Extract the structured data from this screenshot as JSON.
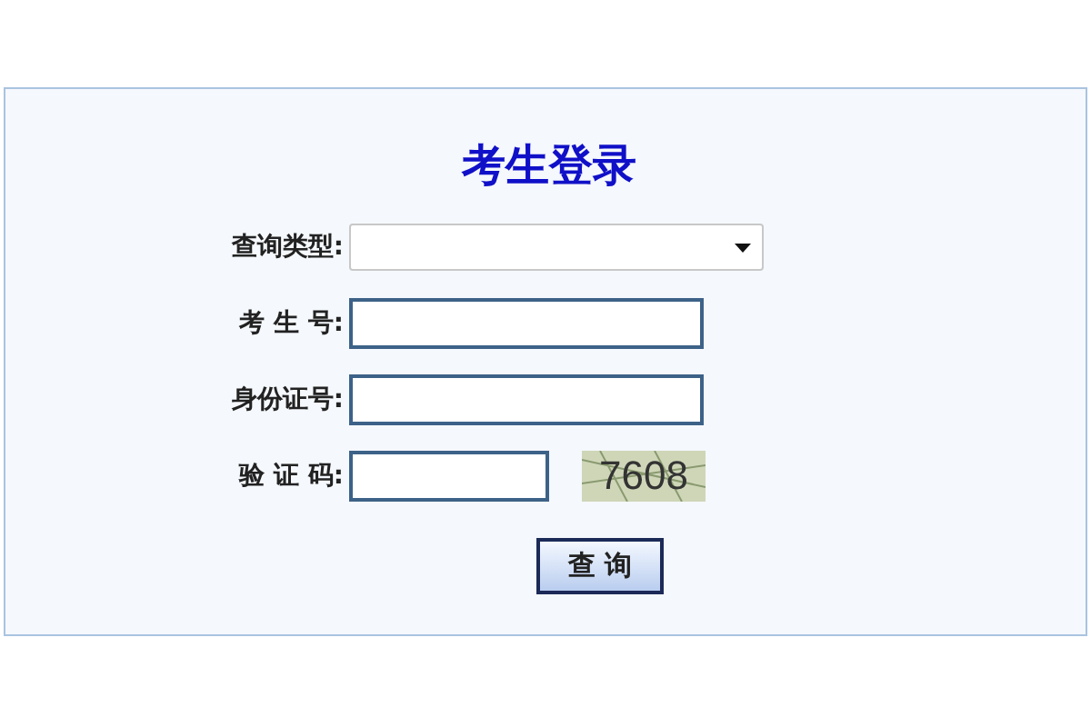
{
  "title": "考生登录",
  "fields": [
    {
      "kind": "select",
      "label": "查询类型:"
    },
    {
      "kind": "text",
      "label": "考 生 号:"
    },
    {
      "kind": "text",
      "label": "身份证号:"
    },
    {
      "kind": "captcha",
      "label": "验 证 码:",
      "code": "7608"
    }
  ],
  "submit": "查 询"
}
